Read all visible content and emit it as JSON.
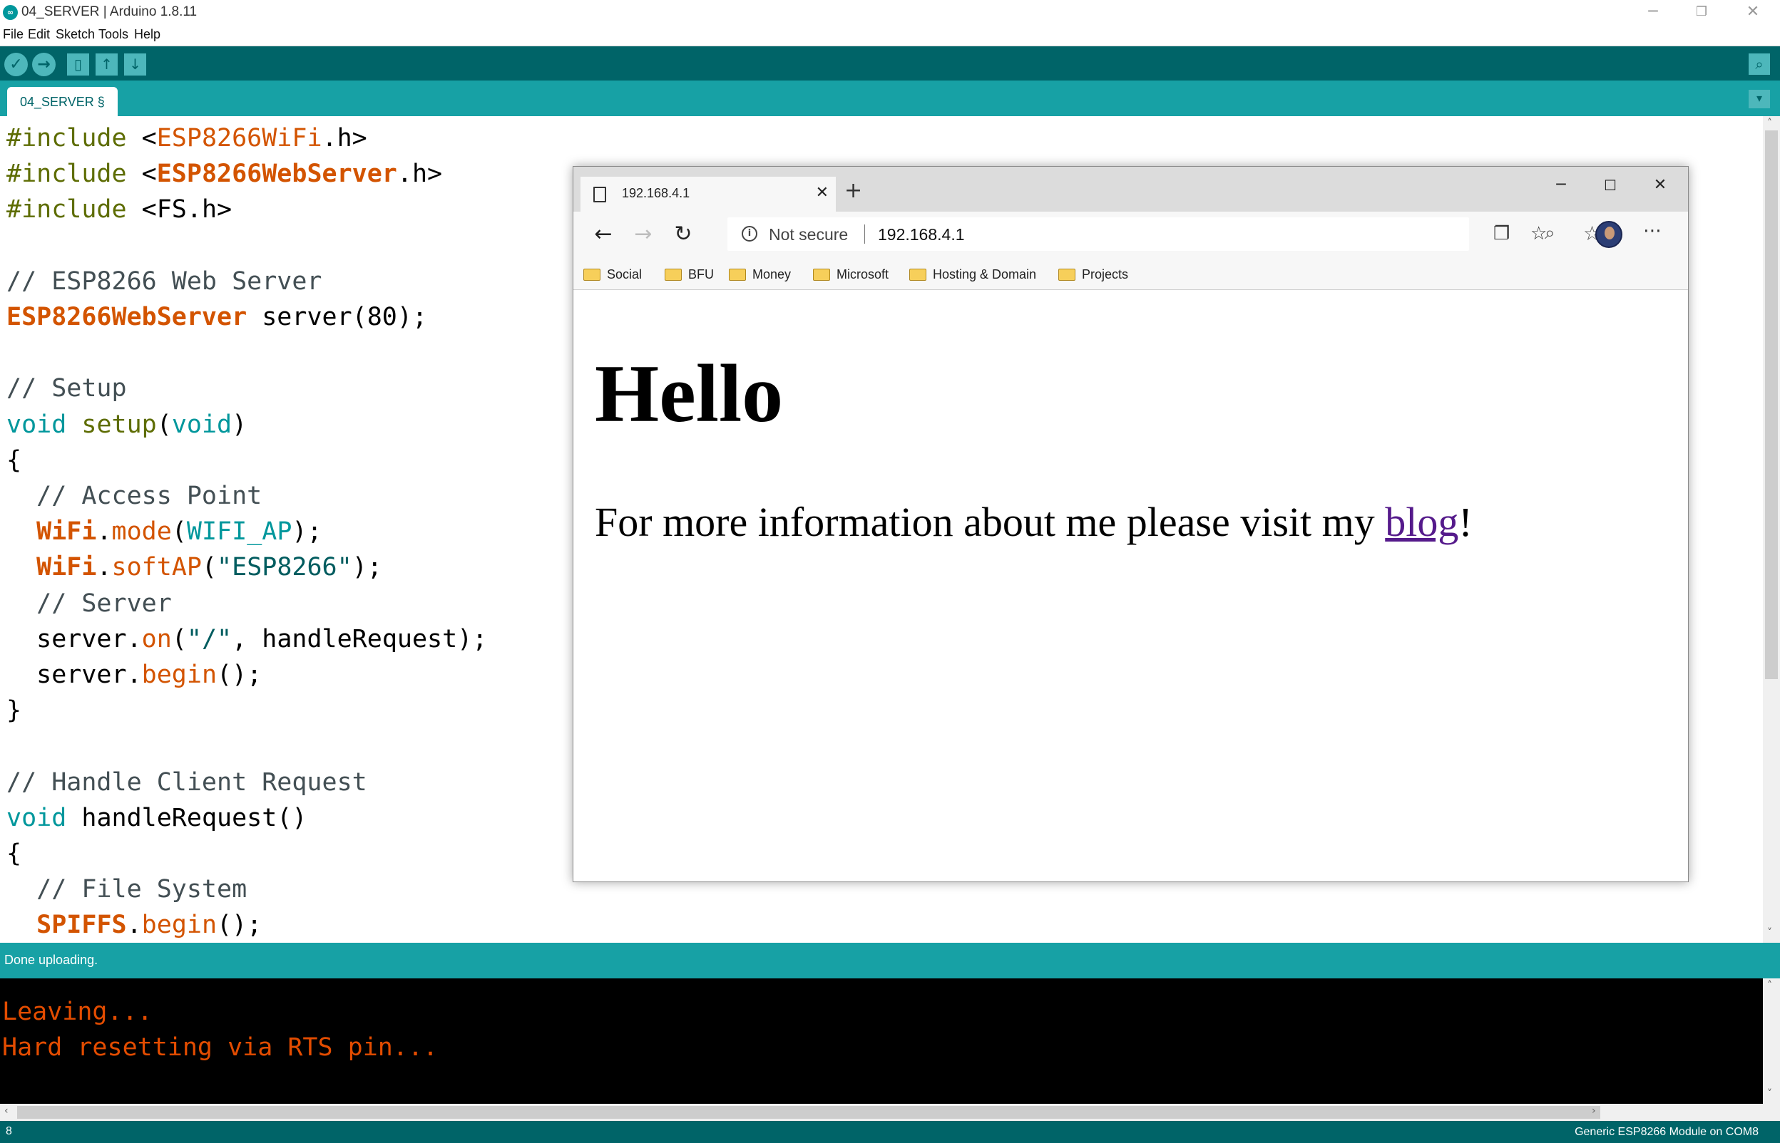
{
  "window": {
    "title": "04_SERVER | Arduino 1.8.11",
    "logo": "arduino-logo",
    "controls": [
      "minimize",
      "restore",
      "close"
    ]
  },
  "menu": [
    "File",
    "Edit",
    "Sketch",
    "Tools",
    "Help"
  ],
  "toolbar": {
    "buttons": [
      "verify",
      "upload",
      "new",
      "open",
      "save"
    ],
    "right_button": "serial-monitor"
  },
  "editor_tab": {
    "label": "04_SERVER §"
  },
  "code_lines": [
    [
      [
        "#include ",
        "k-pre"
      ],
      [
        "<",
        ""
      ],
      [
        "ESP8266WiFi",
        "k-lib"
      ],
      [
        ".h>",
        ""
      ]
    ],
    [
      [
        "#include ",
        "k-pre"
      ],
      [
        "<",
        ""
      ],
      [
        "ESP8266WebServer",
        "k-libb"
      ],
      [
        ".h>",
        ""
      ]
    ],
    [
      [
        "#include ",
        "k-pre"
      ],
      [
        "<FS.h>",
        ""
      ]
    ],
    [],
    [
      [
        "// ESP8266 Web Server",
        "k-cmt"
      ]
    ],
    [
      [
        "ESP8266WebServer",
        "k-libb"
      ],
      [
        " server(80);",
        ""
      ]
    ],
    [],
    [
      [
        "// Setup",
        "k-cmt"
      ]
    ],
    [
      [
        "void",
        "k-type"
      ],
      [
        " ",
        ""
      ],
      [
        "setup",
        "k-fn"
      ],
      [
        "(",
        ""
      ],
      [
        "void",
        "k-type"
      ],
      [
        ")",
        ""
      ]
    ],
    [
      [
        "{",
        ""
      ]
    ],
    [
      [
        "  // Access Point",
        "k-cmt"
      ]
    ],
    [
      [
        "  ",
        ""
      ],
      [
        "WiFi",
        "k-libb"
      ],
      [
        ".",
        ""
      ],
      [
        "mode",
        "k-meth"
      ],
      [
        "(",
        ""
      ],
      [
        "WIFI_AP",
        "k-const"
      ],
      [
        ");",
        ""
      ]
    ],
    [
      [
        "  ",
        ""
      ],
      [
        "WiFi",
        "k-libb"
      ],
      [
        ".",
        ""
      ],
      [
        "softAP",
        "k-meth"
      ],
      [
        "(",
        ""
      ],
      [
        "\"ESP8266\"",
        "k-str"
      ],
      [
        ");",
        ""
      ]
    ],
    [
      [
        "  // Server",
        "k-cmt"
      ]
    ],
    [
      [
        "  server.",
        ""
      ],
      [
        "on",
        "k-meth"
      ],
      [
        "(",
        ""
      ],
      [
        "\"/\"",
        "k-str"
      ],
      [
        ", handleRequest);",
        ""
      ]
    ],
    [
      [
        "  server.",
        ""
      ],
      [
        "begin",
        "k-meth"
      ],
      [
        "();",
        ""
      ]
    ],
    [
      [
        "}",
        ""
      ]
    ],
    [],
    [
      [
        "// Handle Client Request",
        "k-cmt"
      ]
    ],
    [
      [
        "void",
        "k-type"
      ],
      [
        " handleRequest()",
        ""
      ]
    ],
    [
      [
        "{",
        ""
      ]
    ],
    [
      [
        "  // File System",
        "k-cmt"
      ]
    ],
    [
      [
        "  ",
        ""
      ],
      [
        "SPIFFS",
        "k-libb"
      ],
      [
        ".",
        ""
      ],
      [
        "begin",
        "k-meth"
      ],
      [
        "();",
        ""
      ]
    ]
  ],
  "status": {
    "message": "Done uploading."
  },
  "console": [
    "Leaving...",
    "Hard resetting via RTS pin..."
  ],
  "bottom_bar": {
    "line": "8",
    "board": "Generic ESP8266 Module on COM8"
  },
  "browser": {
    "tab_title": "192.168.4.1",
    "security_label": "Not secure",
    "url": "192.168.4.1",
    "bookmarks": [
      "Social",
      "BFU",
      "Money",
      "Microsoft",
      "Hosting & Domain",
      "Projects"
    ],
    "page": {
      "heading": "Hello",
      "paragraph_before": "For more information about me please visit my ",
      "link_text": "blog",
      "paragraph_after": "!"
    }
  },
  "colors": {
    "toolbar": "#006468",
    "tab_bar": "#17a1a5",
    "console_text": "#e34c00",
    "link": "#551a8b"
  }
}
